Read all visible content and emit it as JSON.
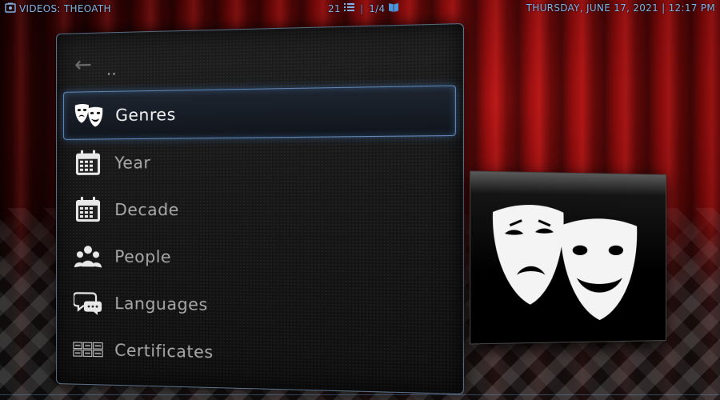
{
  "topbar": {
    "section_label": "VIDEOS: THEOATH",
    "item_count": "21",
    "page_indicator": "1/4",
    "datetime": "THURSDAY, JUNE 17, 2021 | 12:17 PM"
  },
  "menu": {
    "back_label": "..",
    "selected_index": 0,
    "items": [
      {
        "label": "Genres",
        "icon": "theater-masks-icon"
      },
      {
        "label": "Year",
        "icon": "calendar-icon"
      },
      {
        "label": "Decade",
        "icon": "calendar-icon"
      },
      {
        "label": "People",
        "icon": "people-icon"
      },
      {
        "label": "Languages",
        "icon": "speech-bubbles-icon"
      },
      {
        "label": "Certificates",
        "icon": "certificate-badges-icon"
      }
    ]
  },
  "preview": {
    "icon": "theater-masks-icon"
  },
  "colors": {
    "accent": "#7fb2e6",
    "selection_border": "#78aae6",
    "text_normal": "#a9a9a9",
    "text_selected": "#f2f2f2"
  }
}
